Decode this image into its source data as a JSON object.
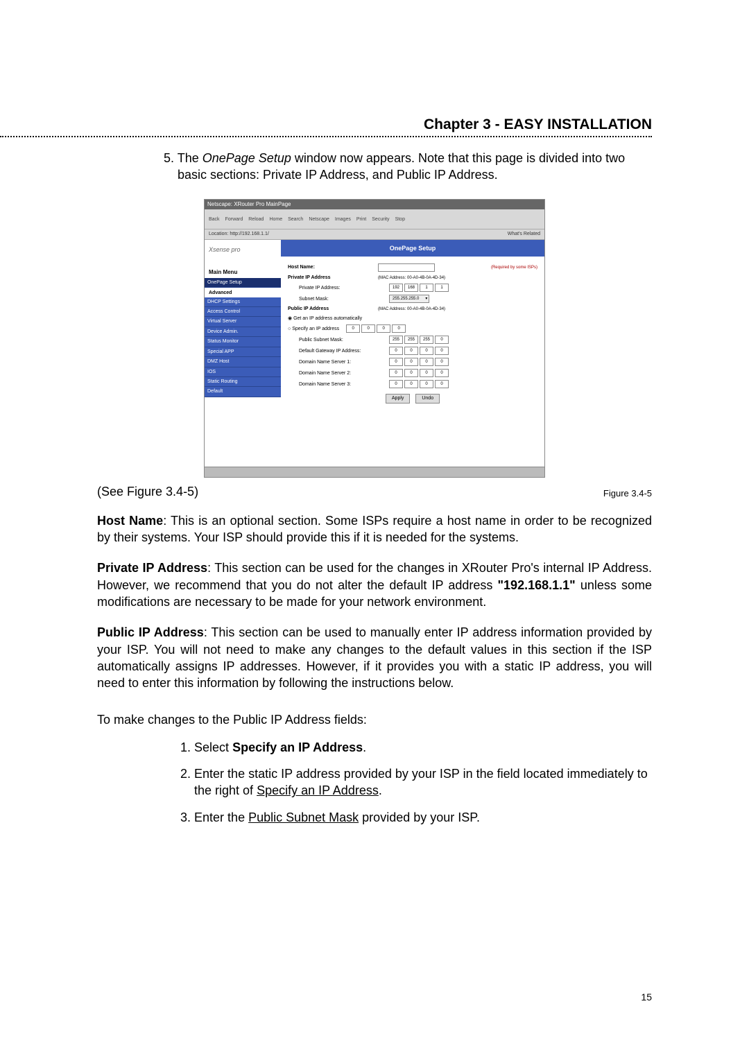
{
  "chapter": {
    "title": "Chapter 3 - EASY INSTALLATION"
  },
  "step5": {
    "num": "5.",
    "text_a": "The ",
    "em": "OnePage Setup",
    "text_b": " window now appears. Note that this page is divided into two basic sections: Private IP Address, and Public IP Address."
  },
  "figure": {
    "label": "Figure 3.4-5",
    "see": "(See Figure 3.4-5)",
    "window_title": "Netscape: XRouter Pro MainPage",
    "toolbar": [
      "Back",
      "Forward",
      "Reload",
      "Home",
      "Search",
      "Netscape",
      "Images",
      "Print",
      "Security",
      "Stop"
    ],
    "location": "Location: http://192.168.1.1/",
    "whats_related": "What's Related",
    "logo": "Xsense pro",
    "main_menu": "Main Menu",
    "nav": [
      "OnePage Setup"
    ],
    "advanced_label": "Advanced",
    "adv_nav": [
      "DHCP Settings",
      "Access Control",
      "Virtual Server",
      "Device Admin.",
      "Status Monitor",
      "Special APP",
      "DMZ Host",
      "IOS",
      "Static Routing",
      "Default"
    ],
    "ops_title": "OnePage Setup",
    "host_name_label": "Host Name:",
    "host_name_note": "(Required by some ISPs)",
    "priv_hdr": "Private IP Address",
    "priv_mac": "(MAC Address: 00-A0-4B-0A-4D-34)",
    "priv_ip_label": "Private IP Address:",
    "priv_ip": [
      "192",
      "168",
      "1",
      "1"
    ],
    "subnet_label": "Subnet Mask:",
    "subnet_sel": "255.255.255.0",
    "pub_hdr": "Public IP Address",
    "pub_mac": "(MAC Address: 00-A0-4B-0A-4D-34)",
    "radio_auto": "Get an IP address automatically",
    "radio_spec": "Specify an IP address",
    "spec_ip": [
      "0",
      "0",
      "0",
      "0"
    ],
    "psm_label": "Public Subnet Mask:",
    "psm_ip": [
      "255",
      "255",
      "255",
      "0"
    ],
    "dg_label": "Default Gateway IP Address:",
    "dg_ip": [
      "0",
      "0",
      "0",
      "0"
    ],
    "dns1_label": "Domain Name Server 1:",
    "dns1_ip": [
      "0",
      "0",
      "0",
      "0"
    ],
    "dns2_label": "Domain Name Server 2:",
    "dns2_ip": [
      "0",
      "0",
      "0",
      "0"
    ],
    "dns3_label": "Domain Name Server 3:",
    "dns3_ip": [
      "0",
      "0",
      "0",
      "0"
    ],
    "btn_apply": "Apply",
    "btn_undo": "Undo"
  },
  "hostname": {
    "b": "Host Name",
    "text": ":   This is an optional section. Some ISPs require a host name in order to be recognized by their systems.  Your ISP should provide this if it is needed for the systems."
  },
  "private": {
    "b": "Private IP Address",
    "t1": ":   This section can be used for the changes in XRouter Pro's internal IP Address. However, we recommend that you do not alter the default IP address ",
    "quote": "\"192.168.1.1\"",
    "t2": " unless some modifications are necessary to be made for your network environment."
  },
  "public": {
    "b": "Public IP Address",
    "text": ":   This section can be used to manually enter IP address information provided by your ISP. You will not need to make any changes to the default values in this section if the ISP automatically assigns IP addresses. However, if it provides you with a static IP address, you will need to enter this information by following the instructions below."
  },
  "subheading": "To make changes to the Public IP Address fields:",
  "list": {
    "i1": {
      "n": "1.",
      "a": "Select ",
      "b": "Specify an IP Address",
      "c": "."
    },
    "i2": {
      "n": "2.",
      "a": "Enter the static IP address provided by your ISP in the field located immediately to the right of ",
      "u": "Specify an IP Address",
      "c": "."
    },
    "i3": {
      "n": "3.",
      "a": "Enter the ",
      "u": "Public Subnet Mask",
      "c": " provided by your ISP."
    }
  },
  "page_num": "15"
}
